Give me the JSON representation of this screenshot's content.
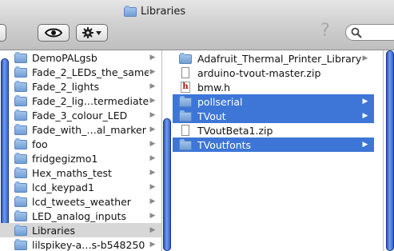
{
  "window": {
    "title": "Libraries",
    "title_icon": "folder-icon"
  },
  "toolbar": {
    "view_icon": "eye-icon",
    "action_icon": "gear-icon",
    "help_glyph": "?",
    "search_icon": "search-icon",
    "search_value": ""
  },
  "column1": {
    "items": [
      {
        "label": "DemoPALgsb",
        "type": "folder"
      },
      {
        "label": "Fade_2_LEDs_the_same",
        "type": "folder"
      },
      {
        "label": "Fade_2_lights",
        "type": "folder"
      },
      {
        "label": "Fade_2_lig…termediate",
        "type": "folder"
      },
      {
        "label": "Fade_3_colour_LED",
        "type": "folder"
      },
      {
        "label": "Fade_with_…al_marker",
        "type": "folder"
      },
      {
        "label": "foo",
        "type": "folder"
      },
      {
        "label": "fridgegizmo1",
        "type": "folder"
      },
      {
        "label": "Hex_maths_test",
        "type": "folder"
      },
      {
        "label": "lcd_keypad1",
        "type": "folder"
      },
      {
        "label": "lcd_tweets_weather",
        "type": "folder"
      },
      {
        "label": "LED_analog_inputs",
        "type": "folder"
      },
      {
        "label": "Libraries",
        "type": "folder",
        "selected": "gray"
      },
      {
        "label": "lilspikey-a…s-b548250",
        "type": "folder"
      }
    ]
  },
  "column2": {
    "items": [
      {
        "label": "Adafruit_Thermal_Printer_Library",
        "type": "folder"
      },
      {
        "label": "arduino-tvout-master.zip",
        "type": "file"
      },
      {
        "label": "bmw.h",
        "type": "header"
      },
      {
        "label": "pollserial",
        "type": "folder",
        "selected": "blue"
      },
      {
        "label": "TVout",
        "type": "folder",
        "selected": "blue"
      },
      {
        "label": "TVoutBeta1.zip",
        "type": "file"
      },
      {
        "label": "TVoutfonts",
        "type": "folder",
        "selected": "blue"
      }
    ]
  },
  "colors": {
    "selection_blue": "#3d76d6",
    "selection_gray": "#d7d7d7",
    "scroller": "#3f6fd8"
  }
}
